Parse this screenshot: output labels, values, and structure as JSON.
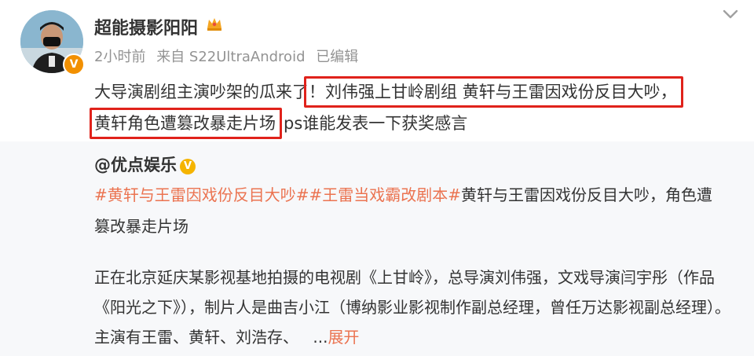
{
  "post": {
    "author": "超能摄影阳阳",
    "time": "2小时前",
    "source": "来自 S22UltraAndroid",
    "edited": "已编辑",
    "text": {
      "part1": "大导演剧组主演吵架的瓜来了",
      "highlight1": "！刘伟强上甘岭剧组  黄轩与王雷因戏份反目大吵，",
      "highlight2": "黄轩角色遭篡改暴走片场",
      "part2": "ps谁能发表一下获奖感言"
    },
    "icons": {
      "avatar": "avatar-photo",
      "verified": "orange-v-badge",
      "crown": "crown-icon",
      "menu": "chevron-down-icon"
    }
  },
  "repost": {
    "author": "@优点娱乐",
    "tag1": "#黄轩与王雷因戏份反目大吵#",
    "tag2": "#王雷当戏霸改剧本#",
    "text": "黄轩与王雷因戏份反目大吵，角色遭篡改暴走片场",
    "body": "正在北京延庆某影视基地拍摄的电视剧《上甘岭》，总导演刘伟强，文戏导演闫宇彤（作品《阳光之下》），制片人是曲吉小江（博纳影业影视制作副总经理，曾任万达影视副总经理）。主演有王雷、黄轩、刘浩存、",
    "ellipsis": "...",
    "expand": "展开"
  },
  "colors": {
    "highlight_box": "#e0221b",
    "topic_orange": "#eb7350",
    "meta_gray": "#939393",
    "card_bg": "#f7f8fa"
  }
}
